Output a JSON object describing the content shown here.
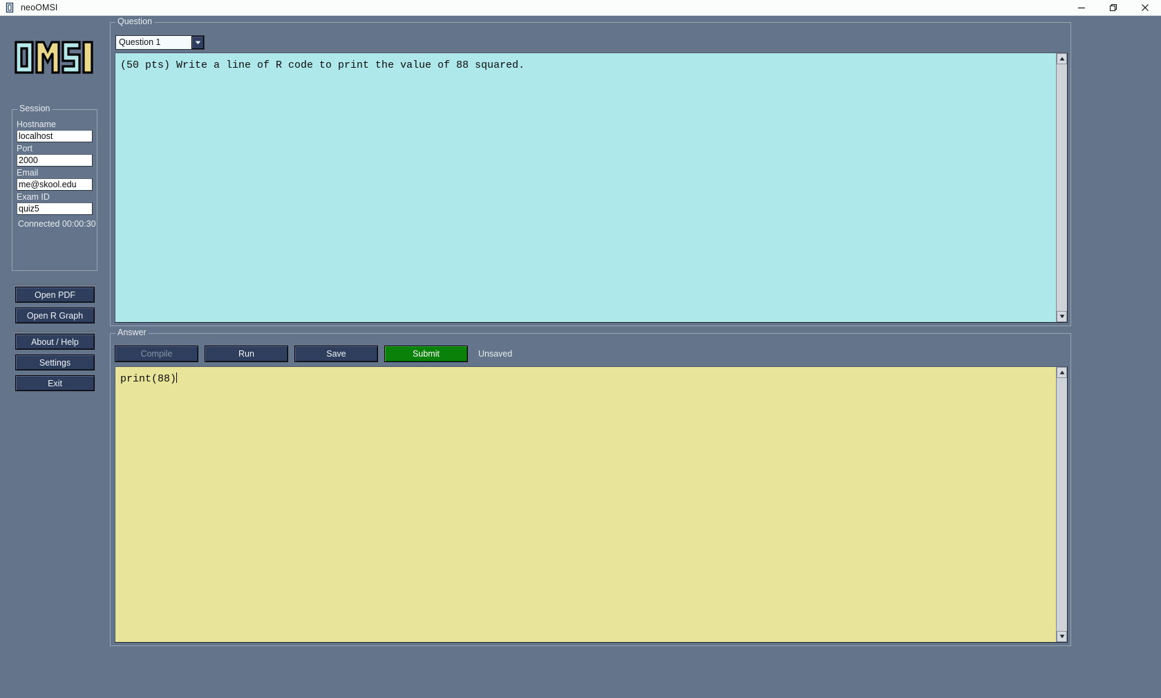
{
  "window": {
    "title": "neoOMSI",
    "icon": "app-window-icon",
    "controls": {
      "minimize": "minimize-icon",
      "restore": "restore-icon",
      "close": "close-icon"
    }
  },
  "sidebar": {
    "logo_text": "OMSI",
    "logo_colors": {
      "cyan": "#b4e8ea",
      "yellow": "#ead98a",
      "outline": "#000000"
    },
    "session": {
      "legend": "Session",
      "fields": [
        {
          "label": "Hostname",
          "value": "localhost",
          "placeholder": "localhost"
        },
        {
          "label": "Port",
          "value": "2000",
          "placeholder": "2000"
        },
        {
          "label": "Email",
          "value": "me@skool.edu",
          "placeholder": "you@school.edu"
        },
        {
          "label": "Exam ID",
          "value": "quiz5",
          "placeholder": "exam id"
        }
      ],
      "connection_status": "Connected 00:00:30"
    },
    "buttons": [
      {
        "label": "Open PDF",
        "enabled": true
      },
      {
        "label": "Open R Graph",
        "enabled": true
      },
      {
        "label": "About / Help",
        "enabled": true
      },
      {
        "label": "Settings",
        "enabled": true
      },
      {
        "label": "Exit",
        "enabled": true
      }
    ]
  },
  "question": {
    "legend": "Question",
    "selector": {
      "selected": "Question 1",
      "options": [
        "Question 1"
      ],
      "arrow_icon": "chevron-down-icon"
    },
    "text": "(50 pts) Write a line of R code to print the value of 88 squared.",
    "background_color": "#afe8ea"
  },
  "answer": {
    "legend": "Answer",
    "toolbar": [
      {
        "label": "Compile",
        "enabled": false,
        "style": "default"
      },
      {
        "label": "Run",
        "enabled": true,
        "style": "default"
      },
      {
        "label": "Save",
        "enabled": true,
        "style": "default"
      },
      {
        "label": "Submit",
        "enabled": true,
        "style": "primary"
      }
    ],
    "status": "Unsaved",
    "code": "print(88)",
    "background_color": "#e8e49a",
    "submit_color": "#0a8209"
  },
  "scrollbars": {
    "up_icon": "scroll-up-arrow-icon",
    "down_icon": "scroll-down-arrow-icon"
  }
}
